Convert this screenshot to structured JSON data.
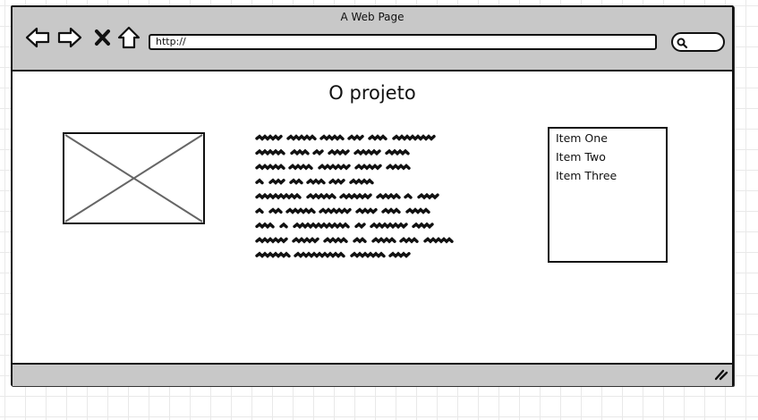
{
  "window": {
    "title": "A Web Page",
    "address": "http://"
  },
  "toolbar": {
    "buttons": [
      {
        "icon": "back-arrow-icon"
      },
      {
        "icon": "forward-arrow-icon"
      },
      {
        "icon": "close-x-icon"
      },
      {
        "icon": "home-icon"
      }
    ],
    "search_icon": "search-icon"
  },
  "page": {
    "heading": "O projeto",
    "image_placeholder_icon": "image-placeholder-icon",
    "list": {
      "items": [
        "Item One",
        "Item Two",
        "Item Three"
      ]
    }
  },
  "statusbar": {
    "grip_icon": "resize-grip-icon"
  }
}
